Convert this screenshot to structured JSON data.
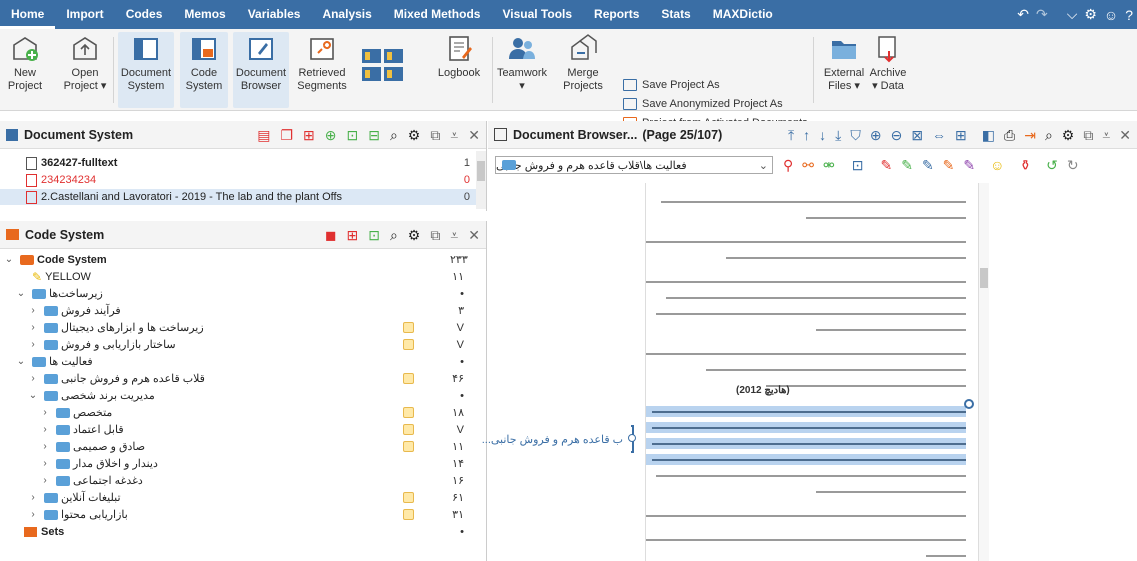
{
  "menu": {
    "items": [
      "Home",
      "Import",
      "Codes",
      "Memos",
      "Variables",
      "Analysis",
      "Mixed Methods",
      "Visual Tools",
      "Reports",
      "Stats",
      "MAXDictio"
    ],
    "active": "Home"
  },
  "ribbon": {
    "new_project": "New\nProject",
    "new_project_l1": "New",
    "new_project_l2": "Project",
    "open_project_l1": "Open",
    "open_project_l2": "Project ▾",
    "doc_system_l1": "Document",
    "doc_system_l2": "System",
    "code_system_l1": "Code",
    "code_system_l2": "System",
    "doc_browser_l1": "Document",
    "doc_browser_l2": "Browser",
    "retrieved_l1": "Retrieved",
    "retrieved_l2": "Segments",
    "logbook": "Logbook",
    "teamwork_l1": "Teamwork",
    "teamwork_l2": "▾",
    "merge_l1": "Merge",
    "merge_l2": "Projects",
    "save_as": "Save Project As",
    "save_anon": "Save Anonymized Project As",
    "project_from": "Project from Activated Documents",
    "external_l1": "External",
    "external_l2": "Files ▾",
    "archive_l1": "Archive",
    "archive_l2": "▾ Data"
  },
  "document_system": {
    "title": "Document System",
    "rows": [
      {
        "name": "362427-fulltext",
        "count": "1",
        "bold": true
      },
      {
        "name": "234234234",
        "count": "0",
        "bold": false
      },
      {
        "name": "2.Castellani and Lavoratori - 2019 - The lab and the plant Offs",
        "count": "0",
        "bold": false
      }
    ]
  },
  "code_system": {
    "title": "Code System",
    "root": {
      "name": "Code System",
      "count": "۲۳۳"
    },
    "rows": [
      {
        "name": "YELLOW",
        "count": "۱۱",
        "indent": 1,
        "memo": false,
        "chev": "",
        "icon": "pen"
      },
      {
        "name": "زیرساخت‌ها",
        "count": "•",
        "indent": 1,
        "memo": false,
        "chev": "v"
      },
      {
        "name": "فرآیند فروش",
        "count": "۳",
        "indent": 2,
        "memo": false,
        "chev": ">"
      },
      {
        "name": "زیرساخت ها و ابزارهای دیجیتال",
        "count": "V",
        "indent": 2,
        "memo": true,
        "chev": ">"
      },
      {
        "name": "ساختار بازاریابی و فروش",
        "count": "V",
        "indent": 2,
        "memo": true,
        "chev": ">"
      },
      {
        "name": "فعالیت ها",
        "count": "•",
        "indent": 1,
        "memo": false,
        "chev": "v"
      },
      {
        "name": "قلاب قاعده هرم و فروش جانبی",
        "count": "۴۶",
        "indent": 2,
        "memo": true,
        "chev": ">"
      },
      {
        "name": "مدیریت برند شخصی",
        "count": "•",
        "indent": 2,
        "memo": false,
        "chev": "v"
      },
      {
        "name": "متخصص",
        "count": "۱۸",
        "indent": 3,
        "memo": true,
        "chev": ">"
      },
      {
        "name": "قابل اعتماد",
        "count": "V",
        "indent": 3,
        "memo": true,
        "chev": ">"
      },
      {
        "name": "صادق و صمیمی",
        "count": "۱۱",
        "indent": 3,
        "memo": true,
        "chev": ">"
      },
      {
        "name": "دیندار و اخلاق مدار",
        "count": "۱۴",
        "indent": 3,
        "memo": false,
        "chev": ">"
      },
      {
        "name": "دغدغه اجتماعی",
        "count": "۱۶",
        "indent": 3,
        "memo": false,
        "chev": ">"
      },
      {
        "name": "تبلیغات آنلاین",
        "count": "۶۱",
        "indent": 2,
        "memo": true,
        "chev": ">"
      },
      {
        "name": "بازاریابی محتوا",
        "count": "۳۱",
        "indent": 2,
        "memo": true,
        "chev": ">"
      }
    ],
    "sets": {
      "name": "Sets",
      "count": "•"
    }
  },
  "document_browser": {
    "title": "Document Browser...",
    "page_info": "(Page 25/107)",
    "code_dropdown": "فعالیت ها\\قلاب قاعده هرم و فروش جانبی",
    "margin_code": "ب قاعده هرم و فروش جانبی...",
    "citation1": "(هادیچ 2012)"
  },
  "colors": {
    "menubar": "#3a6ea5",
    "highlight": "#b9d3ef",
    "memo": "#ffe9a8"
  }
}
